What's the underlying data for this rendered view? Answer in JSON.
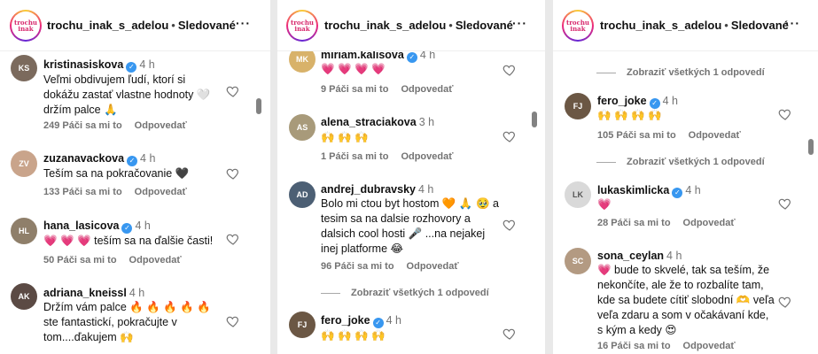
{
  "header": {
    "username": "trochu_inak_s_adelou",
    "separator": "•",
    "follow": "Sledované",
    "more": "···",
    "logo_text": "trochu inak"
  },
  "panel1": {
    "comments": [
      {
        "username": "kristinasiskova",
        "verified": true,
        "time": "4 h",
        "text": "Veľmi obdivujem ľudí, ktorí si dokážu zastať vlastne hodnoty 🤍 držím palce 🙏",
        "likes": "249 Páči sa mi to",
        "reply": "Odpovedať"
      },
      {
        "username": "zuzanavackova",
        "verified": true,
        "time": "4 h",
        "text": "Teším sa na pokračovanie 🖤",
        "likes": "133 Páči sa mi to",
        "reply": "Odpovedať"
      },
      {
        "username": "hana_lasicova",
        "verified": true,
        "time": "4 h",
        "text": "💗 💗 💗 teším sa na ďalšie časti!",
        "likes": "50 Páči sa mi to",
        "reply": "Odpovedať"
      },
      {
        "username": "adriana_kneissl",
        "verified": false,
        "time": "4 h",
        "text": "Držím vám palce 🔥 🔥 🔥 🔥 🔥 ste fantastickí, pokračujte v tom....ďakujem 🙌",
        "likes": "",
        "reply": ""
      }
    ]
  },
  "panel2": {
    "comments": [
      {
        "username": "miriam.kalisova",
        "verified": true,
        "time": "4 h",
        "text": "💗 💗 💗 💗",
        "likes": "9 Páči sa mi to",
        "reply": "Odpovedať"
      },
      {
        "username": "alena_straciakova",
        "verified": false,
        "time": "3 h",
        "text": "🙌 🙌 🙌",
        "likes": "1 Páči sa mi to",
        "reply": "Odpovedať"
      },
      {
        "username": "andrej_dubravsky",
        "verified": false,
        "time": "4 h",
        "text": "Bolo mi ctou byt hostom 🧡 🙏 🥹 a tesim sa na dalsie rozhovory a dalsich cool hosti 🎤 ...na nejakej inej platforme 😂",
        "likes": "96 Páči sa mi to",
        "reply": "Odpovedať"
      },
      {
        "username": "fero_joke",
        "verified": true,
        "time": "4 h",
        "text": "🙌 🙌 🙌 🙌",
        "likes": "",
        "reply": ""
      }
    ],
    "replies_toggle": "Zobraziť všetkých 1 odpovedí"
  },
  "panel3": {
    "top_replies": "Zobraziť všetkých 1 odpovedí",
    "comments": [
      {
        "username": "fero_joke",
        "verified": true,
        "time": "4 h",
        "text": "🙌 🙌 🙌 🙌",
        "likes": "105 Páči sa mi to",
        "reply": "Odpovedať"
      },
      {
        "username": "lukaskimlicka",
        "verified": true,
        "time": "4 h",
        "text": "💗",
        "likes": "28 Páči sa mi to",
        "reply": "Odpovedať"
      },
      {
        "username": "sona_ceylan",
        "verified": false,
        "time": "4 h",
        "text": "💗 bude to skvelé, tak sa teším, že nekončíte, ale že to rozbalíte tam, kde sa budete cítiť slobodní 🫶 veľa veľa zdaru a som v očakávaní kde, s kým a kedy 😍",
        "likes": "16 Páči sa mi to",
        "reply": "Odpovedať"
      }
    ],
    "mid_replies": "Zobraziť všetkých 1 odpovedí"
  },
  "colors": {
    "verified": "#3897f0",
    "muted": "#737373",
    "heart": "#e0245e"
  },
  "icons": {
    "like": "heart-outline-icon",
    "verified": "verified-badge-icon",
    "more": "more-options-icon"
  }
}
